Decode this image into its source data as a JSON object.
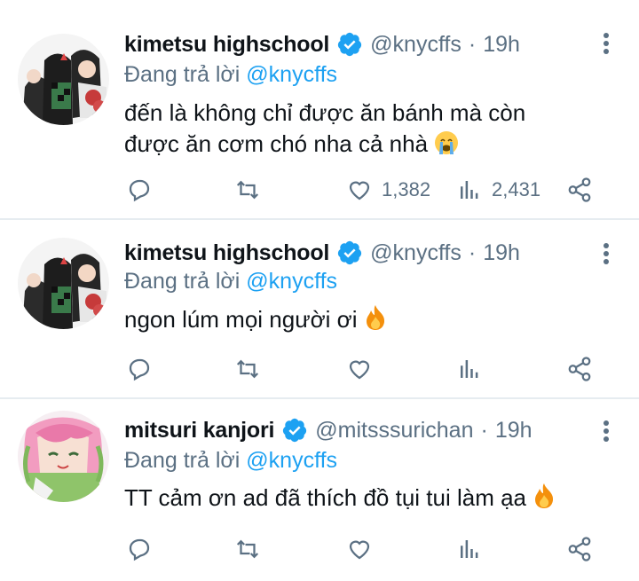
{
  "tweets": [
    {
      "name": "kimetsu highschool",
      "handle": "@knycffs",
      "time": "19h",
      "replying_prefix": "Đang trả lời",
      "replying_to": "@knycffs",
      "text_line1": "đến là không chỉ được ăn bánh mà còn",
      "text_line2": "được ăn cơm chó nha cả nhà",
      "emoji": "crying-face-emoji",
      "likes": "1,382",
      "views": "2,431"
    },
    {
      "name": "kimetsu highschool",
      "handle": "@knycffs",
      "time": "19h",
      "replying_prefix": "Đang trả lời",
      "replying_to": "@knycffs",
      "text_line1": "ngon lúm mọi người ơi",
      "emoji": "fire-emoji"
    },
    {
      "name": "mitsuri kanjori",
      "handle": "@mitsssurichan",
      "time": "19h",
      "replying_prefix": "Đang trả lời",
      "replying_to": "@knycffs",
      "text_line1": "TT cảm ơn ad đã thích đồ tụi tui làm ạa",
      "emoji": "fire-emoji"
    }
  ],
  "colors": {
    "accent": "#1da1f2",
    "secondary_text": "#5b7083",
    "divider": "#e6ecf0"
  }
}
